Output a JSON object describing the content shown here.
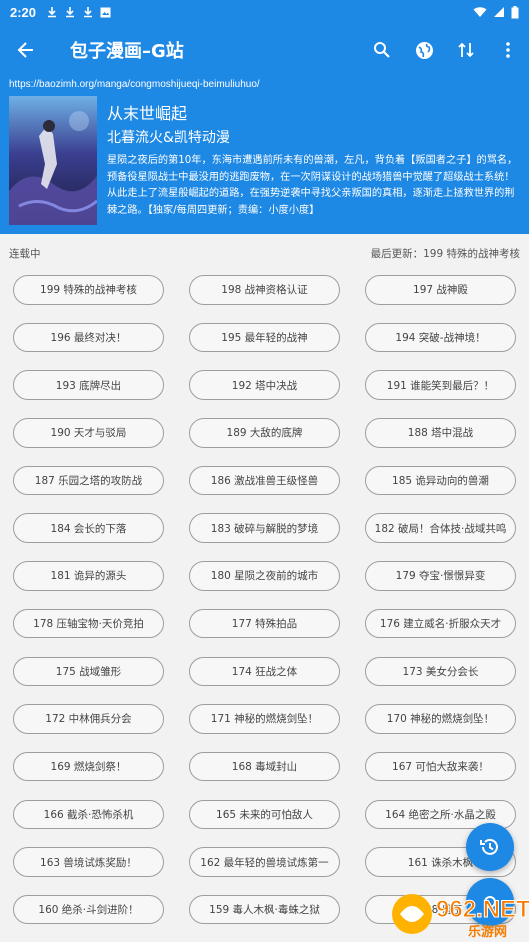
{
  "status_bar": {
    "time": "2:20",
    "notif_icons": [
      "download-icon",
      "download-icon",
      "download-icon",
      "image-icon"
    ]
  },
  "app_bar": {
    "title": "包子漫画–G站",
    "back_icon": "arrow-left-icon",
    "actions": [
      "search-icon",
      "globe-icon",
      "sort-icon",
      "more-vert-icon"
    ]
  },
  "comic": {
    "url": "https://baozimh.org/manga/congmoshijueqi-beimuliuhuo/",
    "title": "从末世崛起",
    "author": "北暮流火&凯特动漫",
    "description": "星陨之夜后的第10年，东海市遭遇前所未有的兽潮，左凡，背负着【叛国者之子】的骂名，预备役星陨战士中最没用的逃跑废物，在一次阴谋设计的战场猎兽中觉醒了超级战士系统！从此走上了流星般崛起的道路，在强势逆袭中寻找父亲叛国的真相，逐渐走上拯救世界的荆棘之路。【独家/每周四更新；责编：小度小度】"
  },
  "info": {
    "status": "连载中",
    "latest": "最后更新：199 特殊的战神考核"
  },
  "chapters": [
    "199 特殊的战神考核",
    "198 战神资格认证",
    "197 战神殿",
    "196 最终对决！",
    "195 最年轻的战神",
    "194 突破-战神境！",
    "193 底牌尽出",
    "192 塔中决战",
    "191 谁能笑到最后？！",
    "190 天才与驳局",
    "189 大敌的底牌",
    "188 塔中混战",
    "187 乐园之塔的攻防战",
    "186 激战准兽王级怪兽",
    "185 诡异动向的兽潮",
    "184 会长的下落",
    "183 破碎与解脱的梦境",
    "182 破局！合体技·战域共鸣",
    "181 诡异的源头",
    "180 星陨之夜前的城市",
    "179 夺宝·憬憬异变",
    "178 压轴宝物·天价竞拍",
    "177 特殊拍品",
    "176 建立威名·折服众天才",
    "175 战域雏形",
    "174 狂战之体",
    "173 美女分会长",
    "172 中林佣兵分会",
    "171 神秘的燃烧剑坠！",
    "170 神秘的燃烧剑坠！",
    "169 燃烧剑祭！",
    "168 毒域封山",
    "167 可怕大敌来袭！",
    "166 截杀·恐怖杀机",
    "165 未来的可怕敌人",
    "164 绝密之所·水晶之殿",
    "163 兽境试炼奖励！",
    "162 最年轻的兽境试炼第一",
    "161 诛杀木枫",
    "160 绝杀·斗剑进阶！",
    "159 毒人木枫·毒蛛之狱",
    "158 兽王"
  ],
  "fabs": [
    "history-icon",
    "action-icon"
  ],
  "colors": {
    "primary": "#1e88e5",
    "background": "#f2f2f2",
    "chip_border": "#9e9e9e"
  },
  "watermark": {
    "text": "962.NET",
    "sub": "乐游网"
  }
}
